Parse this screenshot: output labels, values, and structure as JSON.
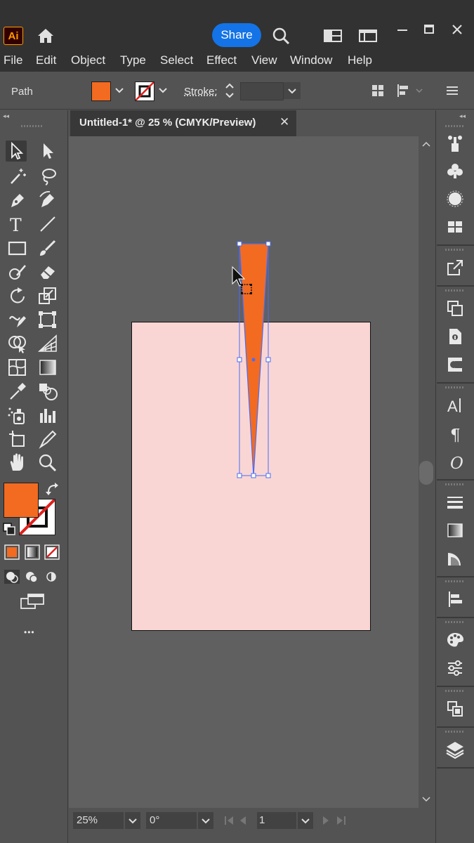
{
  "app": {
    "logo_text": "Ai",
    "share_label": "Share"
  },
  "menu": [
    "File",
    "Edit",
    "Object",
    "Type",
    "Select",
    "Effect",
    "View",
    "Window",
    "Help"
  ],
  "control": {
    "selection_label": "Path",
    "stroke_label": "Stroke:",
    "stroke_value": ""
  },
  "colors": {
    "fill": "#f26b21",
    "artboard": "#f9d6d4",
    "selection": "#4a6cf7",
    "accent": "#1473e6"
  },
  "document": {
    "tab_label": "Untitled-1* @ 25 % (CMYK/Preview)",
    "close_glyph": "✕"
  },
  "status": {
    "zoom": "25%",
    "rotation": "0°",
    "artboard_number": "1"
  },
  "panel": {
    "more_glyph": "•••"
  },
  "icons": {
    "tools": [
      "selection-tool-icon",
      "direct-selection-tool-icon",
      "magic-wand-tool-icon",
      "lasso-tool-icon",
      "pen-tool-icon",
      "curvature-tool-icon",
      "type-tool-icon",
      "line-segment-tool-icon",
      "rectangle-tool-icon",
      "paintbrush-tool-icon",
      "shaper-tool-icon",
      "eraser-tool-icon",
      "rotate-tool-icon",
      "scale-tool-icon",
      "warp-tool-icon",
      "free-transform-tool-icon",
      "shape-builder-tool-icon",
      "perspective-grid-tool-icon",
      "mesh-tool-icon",
      "gradient-tool-icon",
      "eyedropper-tool-icon",
      "blend-tool-icon",
      "symbol-sprayer-tool-icon",
      "column-graph-tool-icon",
      "artboard-tool-icon",
      "slice-tool-icon",
      "hand-tool-icon",
      "zoom-tool-icon"
    ],
    "right_panel": [
      "properties-icon",
      "symbols-icon",
      "brushes-icon",
      "swatches-icon",
      "export-icon",
      "libraries-icon",
      "asset-export-icon",
      "links-icon",
      "character-icon",
      "paragraph-icon",
      "opentype-icon",
      "stroke-icon",
      "gradient-icon",
      "transparency-icon",
      "align-icon",
      "appearance-icon",
      "graphic-styles-icon",
      "artboards-icon",
      "layers-icon"
    ]
  }
}
